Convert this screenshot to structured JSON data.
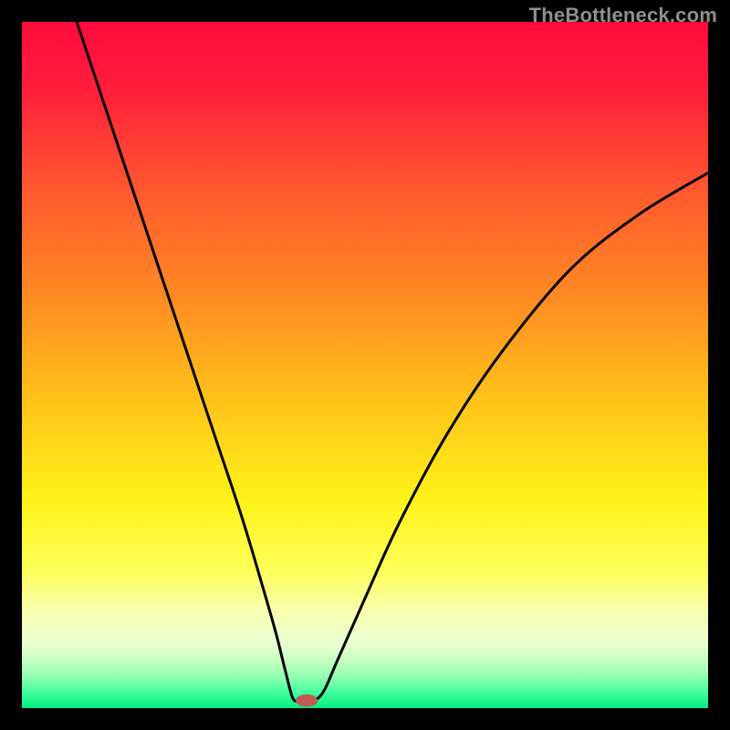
{
  "watermark": "TheBottleneck.com",
  "chart_data": {
    "type": "line",
    "title": "",
    "xlabel": "",
    "ylabel": "",
    "xlim": [
      0,
      100
    ],
    "ylim": [
      0,
      100
    ],
    "grid": false,
    "legend": false,
    "background_gradient": {
      "stops": [
        {
          "offset": 0.0,
          "color": "#ff0a3c"
        },
        {
          "offset": 0.1,
          "color": "#ff1f3b"
        },
        {
          "offset": 0.25,
          "color": "#ff5a2e"
        },
        {
          "offset": 0.4,
          "color": "#ff8a23"
        },
        {
          "offset": 0.55,
          "color": "#ffc21a"
        },
        {
          "offset": 0.7,
          "color": "#fff31a"
        },
        {
          "offset": 0.8,
          "color": "#fdff5a"
        },
        {
          "offset": 0.86,
          "color": "#f8ffb0"
        },
        {
          "offset": 0.905,
          "color": "#eaffd0"
        },
        {
          "offset": 0.93,
          "color": "#c9ffc2"
        },
        {
          "offset": 0.955,
          "color": "#8fffb0"
        },
        {
          "offset": 0.975,
          "color": "#4affa0"
        },
        {
          "offset": 1.0,
          "color": "#00ef82"
        }
      ]
    },
    "series": [
      {
        "name": "bottleneck-curve",
        "x": [
          8.0,
          12.0,
          16.0,
          20.0,
          24.0,
          28.0,
          32.0,
          35.0,
          37.0,
          38.5,
          39.5,
          40.5,
          42.5,
          44.0,
          46.0,
          50.0,
          55.0,
          62.0,
          70.0,
          80.0,
          90.0,
          100.0
        ],
        "y": [
          100.0,
          88.0,
          76.0,
          64.0,
          52.0,
          40.0,
          28.0,
          18.0,
          11.0,
          5.0,
          1.4,
          1.1,
          1.1,
          2.5,
          7.0,
          16.0,
          27.0,
          40.0,
          52.0,
          64.0,
          72.0,
          78.0
        ]
      }
    ],
    "marker": {
      "name": "optimal-point",
      "x": 41.5,
      "y": 1.1,
      "color": "#c05a52",
      "rx": 1.6,
      "ry": 0.9
    }
  }
}
